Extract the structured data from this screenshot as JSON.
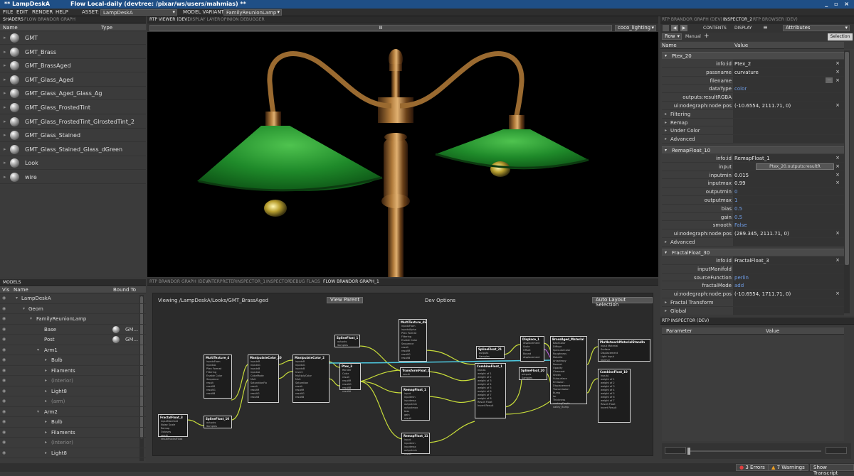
{
  "title": {
    "app": "** LampDeskA",
    "flow": "Flow Local-daily (devtree: /pixar/ws/users/mahmias) **"
  },
  "menu": {
    "file": "FILE",
    "edit": "EDIT",
    "render": "RENDER",
    "help": "HELP",
    "asset_label": "ASSET:",
    "asset_value": "LampDeskA",
    "variant_label": "MODEL VARIANT:",
    "variant_value": "FamilyReunionLamp"
  },
  "shaders": {
    "tabs": [
      "SHADERS",
      "FLOW BRANDOR GRAPH"
    ],
    "col_name": "Name",
    "col_type": "Type",
    "items": [
      "GMT",
      "GMT_Brass",
      "GMT_BrassAged",
      "GMT_Glass_Aged",
      "GMT_Glass_Aged_Glass_Ag",
      "GMT_Glass_FrostedTint",
      "GMT_Glass_FrostedTint_GlrostedTint_2",
      "GMT_Glass_Stained",
      "GMT_Glass_Stained_Glass_dGreen",
      "Look",
      "wire"
    ]
  },
  "models": {
    "tab": "MODELS",
    "col_vis": "Vis",
    "col_name": "Name",
    "col_bound": "Bound To",
    "rows": [
      {
        "name": "LampDeskA",
        "bound": "",
        "dim": false
      },
      {
        "name": "Geom",
        "bound": "",
        "dim": false
      },
      {
        "name": "FamilyReunionLamp",
        "bound": "",
        "dim": false
      },
      {
        "name": "Base",
        "bound": "GM...",
        "dim": false
      },
      {
        "name": "Post",
        "bound": "GM...",
        "dim": false
      },
      {
        "name": "Arm1",
        "bound": "",
        "dim": false
      },
      {
        "name": "Bulb",
        "bound": "",
        "dim": false
      },
      {
        "name": "Filaments",
        "bound": "",
        "dim": false
      },
      {
        "name": "(interior)",
        "bound": "",
        "dim": true
      },
      {
        "name": "Light8",
        "bound": "",
        "dim": false
      },
      {
        "name": "(arm)",
        "bound": "",
        "dim": true
      },
      {
        "name": "Arm2",
        "bound": "",
        "dim": false
      },
      {
        "name": "Bulb",
        "bound": "",
        "dim": false
      },
      {
        "name": "Filaments",
        "bound": "",
        "dim": false
      },
      {
        "name": "(interior)",
        "bound": "",
        "dim": true
      },
      {
        "name": "Light8",
        "bound": "",
        "dim": false
      }
    ]
  },
  "viewer": {
    "tabs": [
      "RTP VIEWER (DEV)",
      "DISPLAY LAYER",
      "OPINION DEBUGGER"
    ],
    "pause": "II",
    "lighting": "coco_lighting"
  },
  "graph": {
    "tabs": [
      "RTP BRANDOR GRAPH (DEV)",
      "INTERPRETER",
      "INSPECTOR_1",
      "INSPECTOR",
      "DEBUG FLAGS",
      "FLOW BRANDOR GRAPH_1"
    ],
    "viewing": "Viewing /LampDeskA/Looks/GMT_BrassAged",
    "view_parent": "View Parent",
    "dev_options": "Dev Options",
    "auto_layout": "Auto Layout Selection",
    "nodes": [
      {
        "title": "MultiTexture_4",
        "ports": [
          "inputsFrom",
          "inputsA",
          "Ptex Format",
          "Filtering",
          "Enable Color",
          "Sequence",
          "result",
          "resultR",
          "resultG",
          "resultB",
          "resultA"
        ]
      },
      {
        "title": "ManipulateColor_20",
        "ports": [
          "inputsR",
          "inputsG",
          "inputsB",
          "inputsA",
          "ColorMode",
          "Mult",
          "SaturationFix",
          "result",
          "resultR",
          "resultG",
          "resultB"
        ]
      },
      {
        "title": "ManipulateColor_2",
        "ports": [
          "inputsR",
          "inputsG",
          "inputsB",
          "Invert",
          "MultiplyColor",
          "Mult",
          "Saturation",
          "result",
          "resultR",
          "resultG",
          "resultB"
        ]
      },
      {
        "title": "SplineFloat_1",
        "ports": [
          "outputs",
          "Samples"
        ]
      },
      {
        "title": "Ptex_3",
        "ports": [
          "Render Color",
          "result",
          "resultR",
          "resultG",
          "resultB",
          "resultA"
        ]
      },
      {
        "title": "MultiTexture_46",
        "ports": [
          "inputsFrom",
          "inputsAlpha",
          "Ptex Format",
          "Filtering",
          "Enable Color",
          "Sequence",
          "result",
          "resultR",
          "resultG",
          "resultB"
        ]
      },
      {
        "title": "TransformFloat_1",
        "ports": [
          "result"
        ]
      },
      {
        "title": "RemapFloat_1",
        "ports": [
          "input",
          "inputmin",
          "inputmax",
          "outputmin",
          "outputmax",
          "bias",
          "gain",
          "result"
        ]
      },
      {
        "title": "RemapFloat_11",
        "ports": [
          "input",
          "inputmin",
          "inputmax",
          "outputmin",
          "result"
        ]
      },
      {
        "title": "SplineFloat_21",
        "ports": [
          "outputs",
          "Samples"
        ]
      },
      {
        "title": "CombineFloat_1",
        "ports": [
          "inputA",
          "weight of 1",
          "weight of 2",
          "weight of 3",
          "weight of 4",
          "weight of 5",
          "weight of 6",
          "weight of 7",
          "weight of 8",
          "Result Float",
          "Invert Result"
        ]
      },
      {
        "title": "Displace_1",
        "ports": [
          "displacement",
          "Scale",
          "Offset",
          "Bound",
          "displacement"
        ]
      },
      {
        "title": "SplineFloat_20",
        "ports": [
          "outputs",
          "Samples"
        ]
      },
      {
        "title": "BrassAged_Material",
        "ports": [
          "BaseColor",
          "Diffuse",
          "SpecularColor",
          "Roughness",
          "Metallic",
          "Anisotropy",
          "Normal",
          "Opacity",
          "Clearcoat",
          "Sheen",
          "Subsurface",
          "Emission",
          "Displacement",
          "Transmission",
          "Bump",
          "Ior",
          "Thickness",
          "coatingDepth",
          "valley_Bump",
          "normal",
          "valley_RampWeight",
          "valley_RampWeight2",
          "valley_RampSmooth"
        ]
      },
      {
        "title": "PbrNetworkMaterialStandIn",
        "ports": [
          "input Material",
          "Surface",
          "Displacement",
          "Light Input",
          "Normal",
          "Bump"
        ]
      },
      {
        "title": "CombineFloat_10",
        "ports": [
          "inputA",
          "weight of 1",
          "weight of 2",
          "weight of 3",
          "weight of 4",
          "weight of 5",
          "weight of 6",
          "weight of 7",
          "Result Float",
          "Invert Result"
        ]
      },
      {
        "title": "FractalFloat_3",
        "ports": [
          "inputManifold",
          "Noise Scale",
          "Remap",
          "Octaves",
          "result",
          "resultFractalFloat"
        ]
      },
      {
        "title": "SplineFloat_10",
        "ports": [
          "outputs",
          "Samples"
        ]
      }
    ]
  },
  "inspector": {
    "tabs": [
      "RTP BRANDOR GRAPH (DEV) 1",
      "INSPECTOR_2",
      "RTP BROWSER (DEV)"
    ],
    "contents": "CONTENTS",
    "display": "DISPLAY",
    "attributes": "Attributes",
    "row": "Row",
    "manual": "Manual",
    "plus": "+",
    "selection": "Selection",
    "col_name": "Name",
    "col_value": "Value",
    "ptex": {
      "title": "Ptex_20",
      "rows": [
        {
          "k": "info:id",
          "v": "Ptex_2"
        },
        {
          "k": "passname",
          "v": "curvature"
        },
        {
          "k": "filename",
          "v": ""
        },
        {
          "k": "dataType",
          "v": "color"
        },
        {
          "k": "outputs:resultRGBA",
          "v": ""
        },
        {
          "k": "ui:nodegraph:node:pos",
          "v": "(-10.6554, 2111.71, 0)"
        }
      ],
      "subs": [
        "Filtering",
        "Remap",
        "Under Color",
        "Advanced"
      ]
    },
    "remap": {
      "title": "RemapFloat_10",
      "rows": [
        {
          "k": "info:id",
          "v": "RemapFloat_1"
        },
        {
          "k": "input",
          "v": "Ptex_20.outputs:resultR"
        },
        {
          "k": "inputmin",
          "v": "0.015"
        },
        {
          "k": "inputmax",
          "v": "0.99"
        },
        {
          "k": "outputmin",
          "v": "0"
        },
        {
          "k": "outputmax",
          "v": "1"
        },
        {
          "k": "bias",
          "v": "0.5"
        },
        {
          "k": "gain",
          "v": "0.5"
        },
        {
          "k": "smooth",
          "v": "False"
        },
        {
          "k": "ui:nodegraph:node:pos",
          "v": "(289.345, 2111.71, 0)"
        }
      ],
      "subs": [
        "Advanced"
      ]
    },
    "fractal": {
      "title": "FractalFloat_30",
      "rows": [
        {
          "k": "info:id",
          "v": "FractalFloat_3"
        },
        {
          "k": "inputManifold",
          "v": ""
        },
        {
          "k": "sourceFunction",
          "v": "perlin"
        },
        {
          "k": "fractalMode",
          "v": "add"
        },
        {
          "k": "ui:nodegraph:node:pos",
          "v": "(-10.6554, 1711.71, 0)"
        }
      ],
      "subs": [
        "Fractal Transform",
        "Global"
      ]
    }
  },
  "rtp_inspector": {
    "tab": "RTP INSPECTOR (DEV)",
    "col_param": "Parameter",
    "col_value": "Value"
  },
  "status": {
    "errors": "3 Errors",
    "warnings": "7 Warnings",
    "transcript": "Show Transcript"
  },
  "colors": {
    "titlebar": "#1f4f86",
    "accent_blue": "#6f9de6",
    "wire_yellow": "#c8dd3a",
    "wire_cyan": "#4ec9e0",
    "lamp_green": "#1f8a2a",
    "brass": "#8a5a2a"
  }
}
